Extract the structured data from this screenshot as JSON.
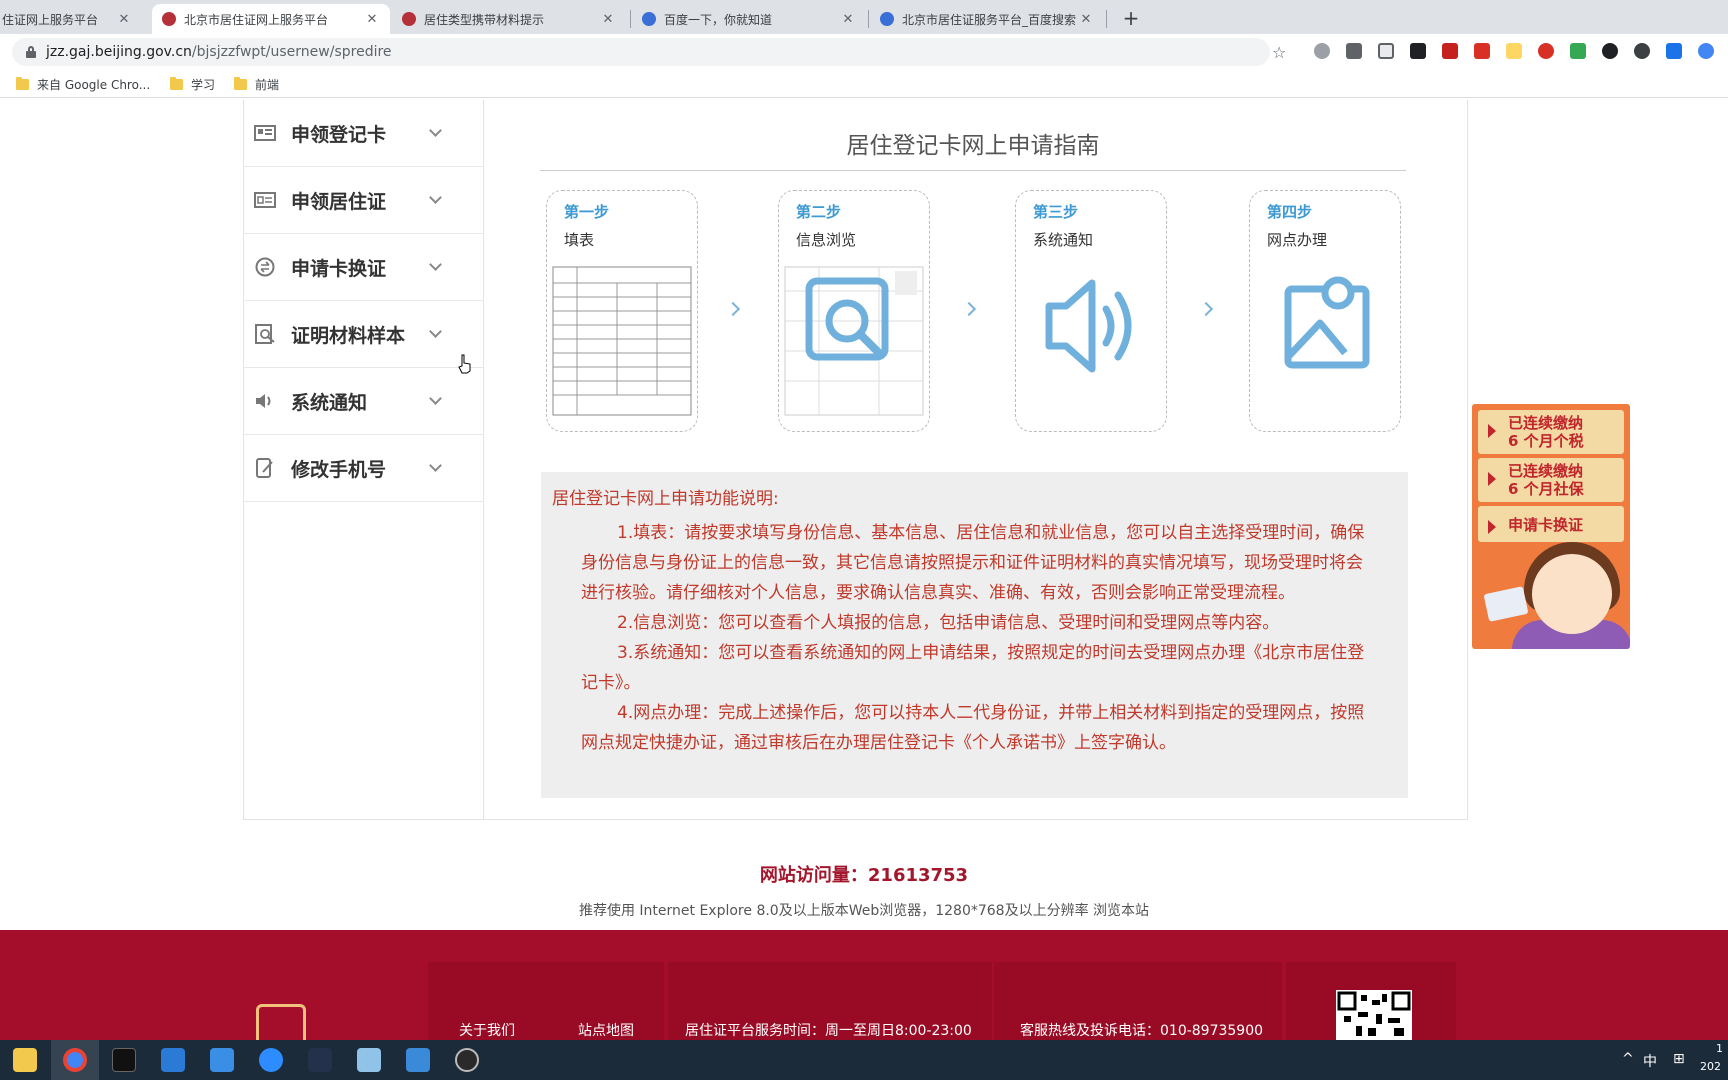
{
  "browser": {
    "tabs": [
      {
        "title": "住证网上服务平台",
        "active": false
      },
      {
        "title": "北京市居住证网上服务平台",
        "active": true
      },
      {
        "title": "居住类型携带材料提示",
        "active": false
      },
      {
        "title": "百度一下，你就知道",
        "active": false
      },
      {
        "title": "北京市居住证服务平台_百度搜索",
        "active": false
      }
    ],
    "tab_close": "✕",
    "new_tab": "+",
    "url_host": "jzz.gaj.beijing.gov.cn",
    "url_path": "/bjsjzzfwpt/usernew/spredire",
    "bookmarks": [
      "来自 Google Chro...",
      "学习",
      "前端"
    ]
  },
  "sidebar": {
    "items": [
      {
        "label": "申领登记卡",
        "icon": "id-card-icon"
      },
      {
        "label": "申领居住证",
        "icon": "residence-card-icon"
      },
      {
        "label": "申请卡换证",
        "icon": "exchange-icon"
      },
      {
        "label": "证明材料样本",
        "icon": "document-search-icon"
      },
      {
        "label": "系统通知",
        "icon": "speaker-icon"
      },
      {
        "label": "修改手机号",
        "icon": "phone-edit-icon"
      }
    ]
  },
  "guide": {
    "title": "居住登记卡网上申请指南",
    "steps": [
      {
        "num": "第一步",
        "name": "填表",
        "icon": "form-document-icon"
      },
      {
        "num": "第二步",
        "name": "信息浏览",
        "icon": "magnifier-icon"
      },
      {
        "num": "第三步",
        "name": "系统通知",
        "icon": "speaker-icon"
      },
      {
        "num": "第四步",
        "name": "网点办理",
        "icon": "map-location-icon"
      }
    ]
  },
  "description": {
    "title": "居住登记卡网上申请功能说明:",
    "paragraphs": [
      "1.填表：请按要求填写身份信息、基本信息、居住信息和就业信息，您可以自主选择受理时间，确保身份信息与身份证上的信息一致，其它信息请按照提示和证件证明材料的真实情况填写，现场受理时将会进行核验。请仔细核对个人信息，要求确认信息真实、准确、有效，否则会影响正常受理流程。",
      "2.信息浏览：您可以查看个人填报的信息，包括申请信息、受理时间和受理网点等内容。",
      "3.系统通知：您可以查看系统通知的网上申请结果，按照规定的时间去受理网点办理《北京市居住登记卡》。",
      "4.网点办理：完成上述操作后，您可以持本人二代身份证，并带上相关材料到指定的受理网点，按照网点规定快捷办证，通过审核后在办理居住登记卡《个人承诺书》上签字确认。"
    ]
  },
  "promo": {
    "items": [
      "已连续缴纳\n6 个月个税",
      "已连续缴纳\n6 个月社保",
      "申请卡换证"
    ]
  },
  "footer": {
    "visits_label": "网站访问量：21613753",
    "browser_note": "推荐使用 Internet Explore 8.0及以上版本Web浏览器，1280*768及以上分辨率 浏览本站",
    "links": [
      "关于我们",
      "站点地图"
    ],
    "service_time": "居住证平台服务时间：周一至周日8:00-23:00",
    "hotline": "客服热线及投诉电话：010-89735900"
  },
  "taskbar": {
    "tray_ime": "中",
    "tray_grid": "⊞",
    "clock_top": "1",
    "clock_bottom": "202"
  },
  "colors": {
    "accent_blue": "#3d9ad3",
    "desc_red": "#c0392b",
    "footer_red": "#a50e2a",
    "promo_orange": "#f07b3f"
  }
}
